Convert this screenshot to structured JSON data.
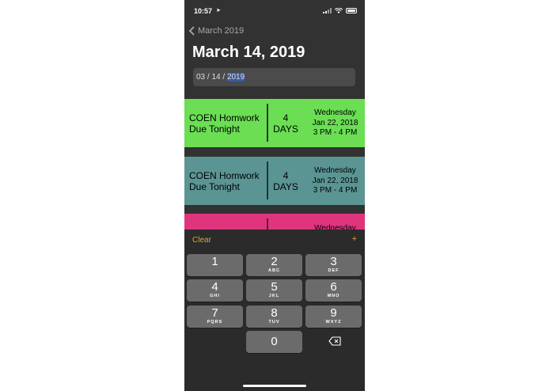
{
  "status": {
    "time": "10:57",
    "location_icon": "location-arrow-icon"
  },
  "nav": {
    "back_label": "March 2019",
    "title": "March 14, 2019"
  },
  "date_field": {
    "month": "03",
    "sep1": " / ",
    "day": "14",
    "sep2": " / ",
    "year": "2019"
  },
  "events": [
    {
      "name_line1": "COEN Homwork",
      "name_line2": "Due Tonight",
      "days_num": "4",
      "days_label": "DAYS",
      "weekday": "Wednesday",
      "date": "Jan 22, 2018",
      "time": "3 PM - 4 PM",
      "color": "#6bde54"
    },
    {
      "name_line1": "COEN Homwork",
      "name_line2": "Due Tonight",
      "days_num": "4",
      "days_label": "DAYS",
      "weekday": "Wednesday",
      "date": "Jan 22, 2018",
      "time": "3 PM - 4 PM",
      "color": "#5b9593"
    },
    {
      "weekday": "Wednesday",
      "color": "#e0347d"
    }
  ],
  "keyboard": {
    "clear_label": "Clear",
    "plus_label": "+",
    "keys": [
      {
        "num": "1",
        "letters": ""
      },
      {
        "num": "2",
        "letters": "ABC"
      },
      {
        "num": "3",
        "letters": "DEF"
      },
      {
        "num": "4",
        "letters": "GHI"
      },
      {
        "num": "5",
        "letters": "JKL"
      },
      {
        "num": "6",
        "letters": "MNO"
      },
      {
        "num": "7",
        "letters": "PQRS"
      },
      {
        "num": "8",
        "letters": "TUV"
      },
      {
        "num": "9",
        "letters": "WXYZ"
      },
      {
        "num": "0",
        "letters": ""
      }
    ],
    "accent_color": "#d8a23c"
  }
}
